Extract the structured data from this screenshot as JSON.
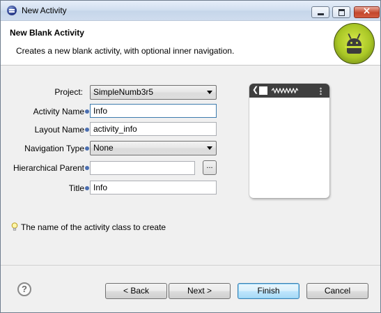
{
  "window": {
    "title": "New Activity",
    "close_glyph": "×"
  },
  "header": {
    "title": "New Blank Activity",
    "description": "Creates a new blank activity, with optional inner navigation.",
    "logo": "android-logo"
  },
  "form": {
    "project": {
      "label": "Project:",
      "value": "SimpleNumb3r5"
    },
    "activity_name": {
      "label": "Activity Name",
      "value": "Info"
    },
    "layout_name": {
      "label": "Layout Name",
      "value": "activity_info"
    },
    "navigation_type": {
      "label": "Navigation Type",
      "value": "None"
    },
    "hierarchical_parent": {
      "label": "Hierarchical Parent",
      "value": "",
      "browse_label": "..."
    },
    "title": {
      "label": "Title",
      "value": "Info"
    }
  },
  "preview": {
    "back_glyph": "❮"
  },
  "hint": {
    "text": "The name of the activity class to create"
  },
  "footer": {
    "help": "?",
    "back": "< Back",
    "next": "Next >",
    "finish": "Finish",
    "cancel": "Cancel"
  }
}
